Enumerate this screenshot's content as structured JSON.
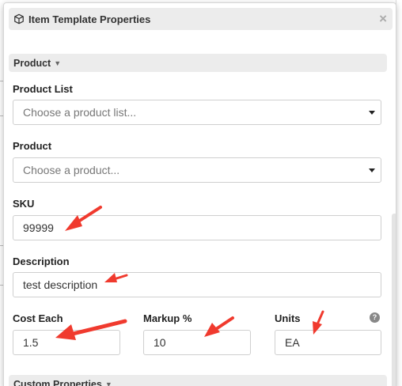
{
  "dialog": {
    "title": "Item Template Properties",
    "close": "×"
  },
  "sections": {
    "product": "Product",
    "custom": "Custom Properties"
  },
  "fields": {
    "product_list": {
      "label": "Product List",
      "placeholder": "Choose a product list..."
    },
    "product": {
      "label": "Product",
      "placeholder": "Choose a product..."
    },
    "sku": {
      "label": "SKU",
      "value": "99999"
    },
    "description": {
      "label": "Description",
      "value": "test description"
    },
    "cost_each": {
      "label": "Cost Each",
      "value": "1.5"
    },
    "markup": {
      "label": "Markup %",
      "value": "10"
    },
    "units": {
      "label": "Units",
      "value": "EA"
    }
  },
  "help_glyph": "?",
  "annotation_color": "#f03a2e"
}
